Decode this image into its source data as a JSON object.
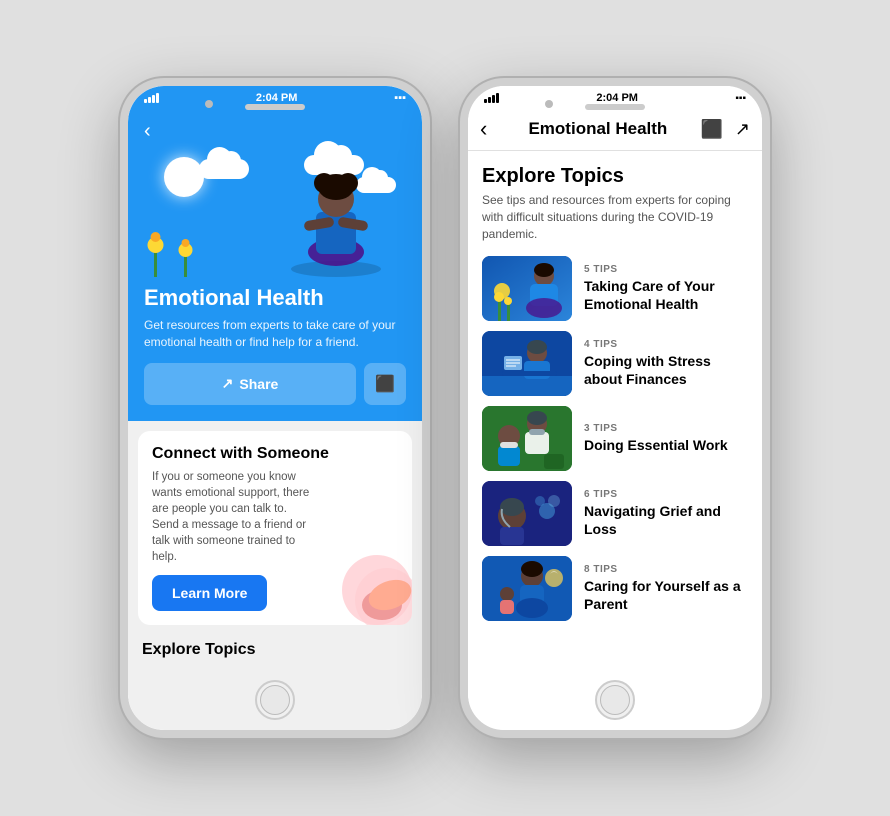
{
  "scene": {
    "background": "#e0e0e0"
  },
  "phone1": {
    "status_bar": {
      "signal": "full",
      "wifi": true,
      "time": "2:04 PM",
      "battery": "full"
    },
    "hero": {
      "title": "Emotional Health",
      "description": "Get resources from experts to take care of your emotional health or find help for a friend.",
      "share_label": "Share",
      "bookmark_icon": "bookmark"
    },
    "connect_card": {
      "title": "Connect with Someone",
      "description": "If you or someone you know wants emotional support, there are people you can talk to. Send a message to a friend or talk with someone trained to help.",
      "learn_more_label": "Learn More"
    },
    "explore_header": "Explore Topics"
  },
  "phone2": {
    "status_bar": {
      "signal": "full",
      "wifi": true,
      "time": "2:04 PM",
      "battery": "full"
    },
    "nav": {
      "back_icon": "‹",
      "title": "Emotional Health",
      "bookmark_icon": "bookmark",
      "share_icon": "share"
    },
    "explore": {
      "title": "Explore Topics",
      "description": "See tips and resources from experts for coping with difficult situations during the COVID-19 pandemic."
    },
    "topics": [
      {
        "tips_count": "5 TIPS",
        "title": "Taking Care of Your Emotional Health",
        "thumb_class": "illus1"
      },
      {
        "tips_count": "4 TIPS",
        "title": "Coping with Stress about Finances",
        "thumb_class": "illus2"
      },
      {
        "tips_count": "3 TIPS",
        "title": "Doing Essential Work",
        "thumb_class": "illus3"
      },
      {
        "tips_count": "6 TIPS",
        "title": "Navigating Grief and Loss",
        "thumb_class": "illus4"
      },
      {
        "tips_count": "8 TIPS",
        "title": "Caring for Yourself as a Parent",
        "thumb_class": "illus5"
      }
    ]
  }
}
